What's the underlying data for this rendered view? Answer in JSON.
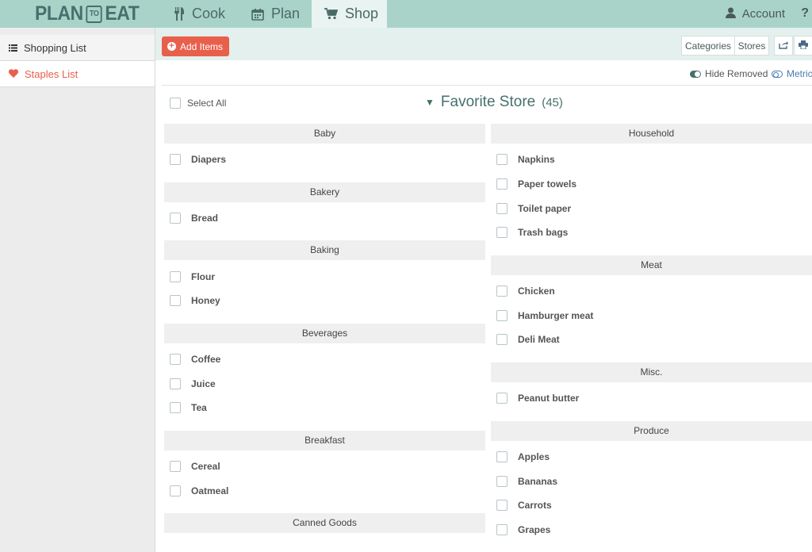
{
  "nav": {
    "logo": {
      "left": "PLAN",
      "middle": "TO",
      "right": "EAT"
    },
    "tabs": [
      {
        "label": "Cook",
        "icon": "utensils-icon"
      },
      {
        "label": "Plan",
        "icon": "calendar-icon"
      },
      {
        "label": "Shop",
        "icon": "cart-icon",
        "active": true
      }
    ],
    "account_label": "Account",
    "help_label": "?"
  },
  "sidebar": {
    "items": [
      {
        "label": "Shopping List",
        "icon": "list-icon"
      },
      {
        "label": "Staples List",
        "icon": "heart-icon",
        "active": true
      }
    ]
  },
  "toolbar": {
    "add_items_label": "Add Items",
    "categories_label": "Categories",
    "stores_label": "Stores"
  },
  "options": {
    "hide_removed_label": "Hide Removed",
    "metric_label": "Metric"
  },
  "list": {
    "select_all_label": "Select All",
    "store_name": "Favorite Store",
    "store_count": "(45)",
    "left_column": [
      {
        "name": "Baby",
        "items": [
          "Diapers"
        ]
      },
      {
        "name": "Bakery",
        "items": [
          "Bread"
        ]
      },
      {
        "name": "Baking",
        "items": [
          "Flour",
          "Honey"
        ]
      },
      {
        "name": "Beverages",
        "items": [
          "Coffee",
          "Juice",
          "Tea"
        ]
      },
      {
        "name": "Breakfast",
        "items": [
          "Cereal",
          "Oatmeal"
        ]
      },
      {
        "name": "Canned Goods",
        "items": []
      }
    ],
    "right_column": [
      {
        "name": "Household",
        "items": [
          "Napkins",
          "Paper towels",
          "Toilet paper",
          "Trash bags"
        ]
      },
      {
        "name": "Meat",
        "items": [
          "Chicken",
          "Hamburger meat",
          "Deli Meat"
        ]
      },
      {
        "name": "Misc.",
        "items": [
          "Peanut butter"
        ]
      },
      {
        "name": "Produce",
        "items": [
          "Apples",
          "Bananas",
          "Carrots",
          "Grapes"
        ]
      }
    ]
  },
  "colors": {
    "nav_bg": "#a9d3c8",
    "accent": "#e8604c",
    "brand_dark": "#45706d"
  }
}
